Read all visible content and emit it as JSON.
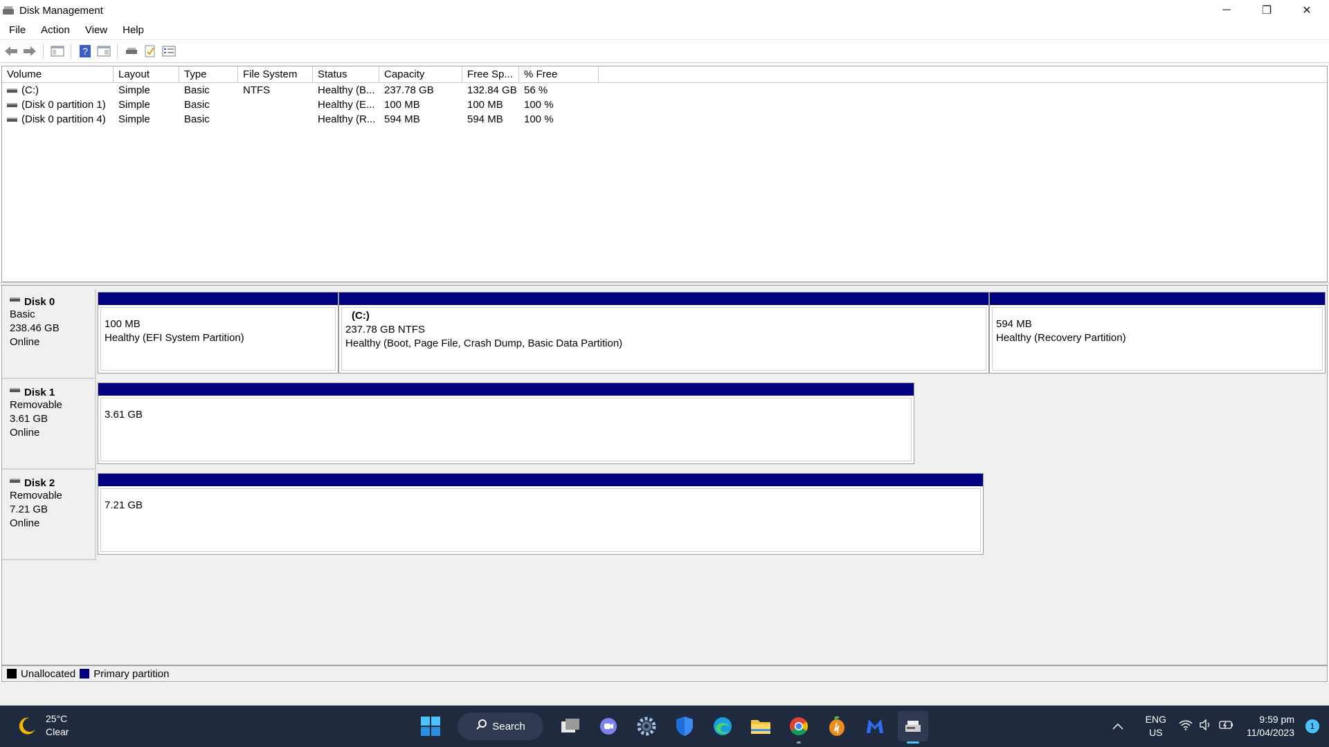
{
  "window": {
    "title": "Disk Management",
    "minimize": "─",
    "restore": "❐",
    "close": "✕"
  },
  "menu": [
    "File",
    "Action",
    "View",
    "Help"
  ],
  "toolbar_icons": [
    "back-icon",
    "forward-icon",
    "console-tree-icon",
    "help-icon",
    "properties-pane-icon",
    "connect-drive-icon",
    "checklist-icon",
    "settings-list-icon"
  ],
  "volume_table": {
    "columns": [
      "Volume",
      "Layout",
      "Type",
      "File System",
      "Status",
      "Capacity",
      "Free Sp...",
      "% Free"
    ],
    "rows": [
      {
        "volume": "(C:)",
        "layout": "Simple",
        "type": "Basic",
        "fs": "NTFS",
        "status": "Healthy (B...",
        "capacity": "237.78 GB",
        "free": "132.84 GB",
        "pct": "56 %"
      },
      {
        "volume": "(Disk 0 partition 1)",
        "layout": "Simple",
        "type": "Basic",
        "fs": "",
        "status": "Healthy (E...",
        "capacity": "100 MB",
        "free": "100 MB",
        "pct": "100 %"
      },
      {
        "volume": "(Disk 0 partition 4)",
        "layout": "Simple",
        "type": "Basic",
        "fs": "",
        "status": "Healthy (R...",
        "capacity": "594 MB",
        "free": "594 MB",
        "pct": "100 %"
      }
    ]
  },
  "disks": [
    {
      "name": "Disk 0",
      "kind": "Basic",
      "size": "238.46 GB",
      "state": "Online",
      "partitions": [
        {
          "label": "",
          "size": "100 MB",
          "status": "Healthy (EFI System Partition)"
        },
        {
          "label": "(C:)",
          "size": "237.78 GB NTFS",
          "status": "Healthy (Boot, Page File, Crash Dump, Basic Data Partition)"
        },
        {
          "label": "",
          "size": "594 MB",
          "status": "Healthy (Recovery Partition)"
        }
      ]
    },
    {
      "name": "Disk 1",
      "kind": "Removable",
      "size": "3.61 GB",
      "state": "Online",
      "partitions": [
        {
          "label": "",
          "size": "3.61 GB",
          "status": ""
        }
      ]
    },
    {
      "name": "Disk 2",
      "kind": "Removable",
      "size": "7.21 GB",
      "state": "Online",
      "partitions": [
        {
          "label": "",
          "size": "7.21 GB",
          "status": ""
        }
      ]
    }
  ],
  "legend": [
    {
      "label": "Unallocated",
      "color": "#000000"
    },
    {
      "label": "Primary partition",
      "color": "#010080"
    }
  ],
  "taskbar": {
    "weather_temp": "25°C",
    "weather_desc": "Clear",
    "search_label": "Search",
    "apps": [
      "start-icon",
      "task-view-icon",
      "chat-icon",
      "settings-icon",
      "defender-icon",
      "edge-icon",
      "file-explorer-icon",
      "chrome-icon",
      "fl-studio-icon",
      "malwarebytes-icon",
      "disk-management-icon"
    ],
    "lang_top": "ENG",
    "lang_bottom": "US",
    "time": "9:59 pm",
    "date": "11/04/2023",
    "notification_count": "1"
  }
}
